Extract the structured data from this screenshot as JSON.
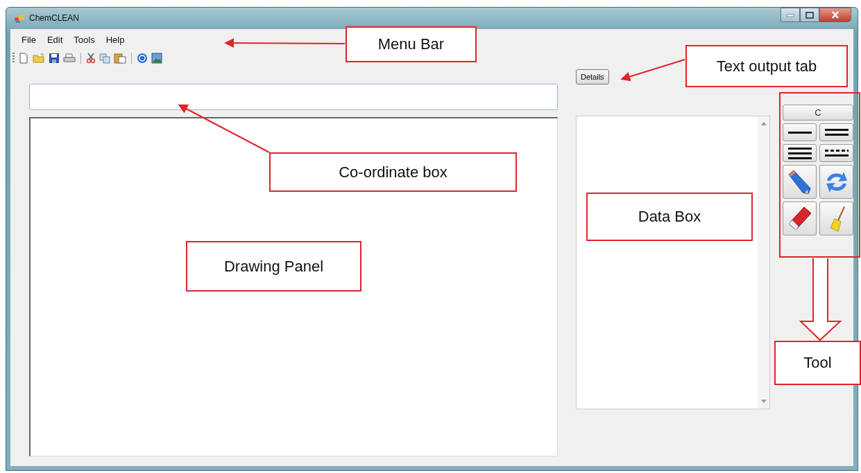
{
  "window": {
    "title": "ChemCLEAN"
  },
  "menu": [
    "File",
    "Edit",
    "Tools",
    "Help"
  ],
  "details_button": "Details",
  "tool_panel": {
    "tools": [
      {
        "kind": "text",
        "label": "C"
      },
      {
        "kind": "single-bond"
      },
      {
        "kind": "double-bond"
      },
      {
        "kind": "triple-bond"
      },
      {
        "kind": "dashed-bond"
      },
      {
        "kind": "pencil"
      },
      {
        "kind": "refresh"
      },
      {
        "kind": "eraser"
      },
      {
        "kind": "broom"
      }
    ]
  },
  "annotations": [
    {
      "label": "Menu Bar"
    },
    {
      "label": "Text output tab"
    },
    {
      "label": "Co-ordinate box"
    },
    {
      "label": "Data Box"
    },
    {
      "label": "Drawing Panel"
    },
    {
      "label": "Tool"
    }
  ]
}
